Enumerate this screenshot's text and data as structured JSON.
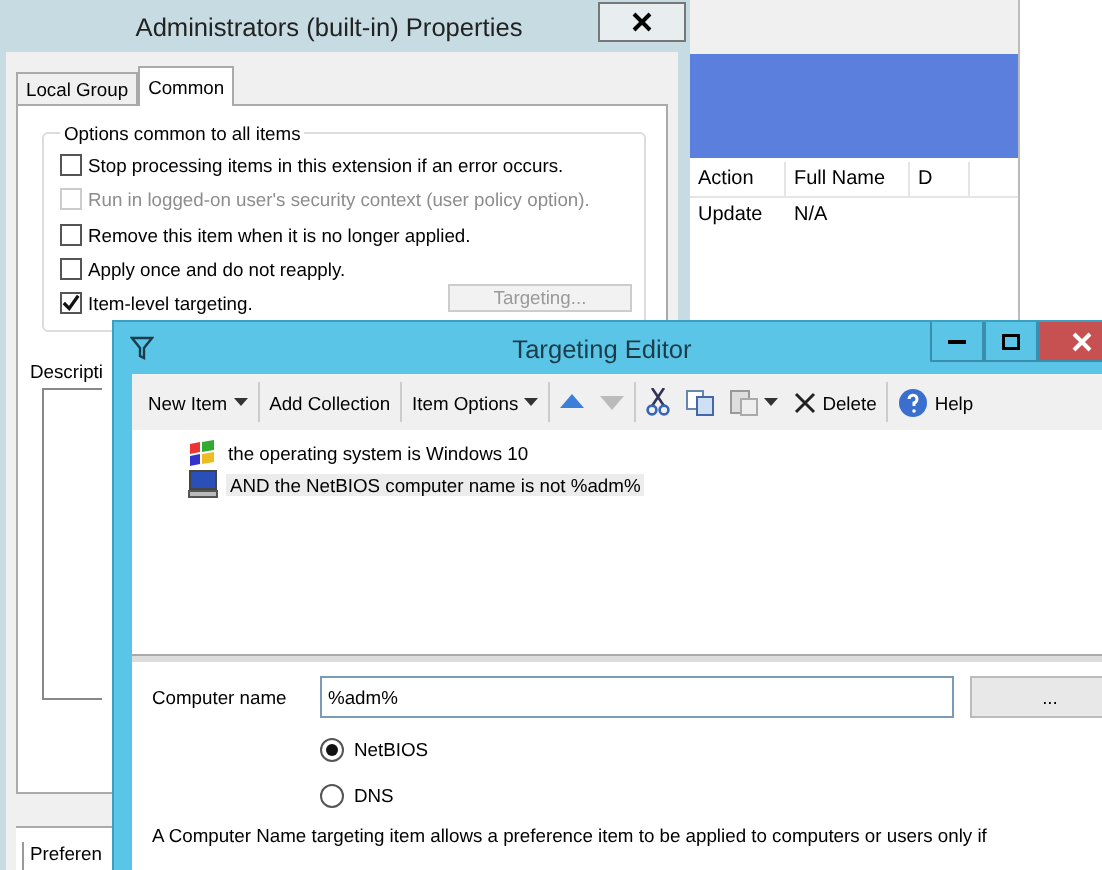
{
  "background_window": {
    "columns": [
      "Action",
      "Full Name",
      "D"
    ],
    "rows": [
      [
        "Update",
        "N/A"
      ]
    ]
  },
  "properties_dialog": {
    "title": "Administrators (built-in) Properties",
    "tabs": [
      {
        "label": "Local Group",
        "selected": false
      },
      {
        "label": "Common",
        "selected": true
      }
    ],
    "group_title": "Options common to all items",
    "options": [
      {
        "label": "Stop processing items in this extension if an error occurs.",
        "checked": false,
        "disabled": false
      },
      {
        "label": "Run in logged-on user's security context (user policy option).",
        "checked": false,
        "disabled": true
      },
      {
        "label": "Remove this item when it is no longer applied.",
        "checked": false,
        "disabled": false
      },
      {
        "label": "Apply once and do not reapply.",
        "checked": false,
        "disabled": false
      },
      {
        "label": "Item-level targeting.",
        "checked": true,
        "disabled": false
      }
    ],
    "targeting_button": {
      "label": "Targeting...",
      "disabled": true
    },
    "description_label": "Descripti",
    "bottom_tab": "Preferen"
  },
  "targeting_editor": {
    "title": "Targeting Editor",
    "toolbar": {
      "new_item": "New Item",
      "add_collection": "Add Collection",
      "item_options": "Item Options",
      "move_down_disabled": true,
      "paste_disabled": true,
      "delete": "Delete",
      "help": "Help"
    },
    "items": [
      {
        "kind": "os",
        "text": "the operating system is Windows 10",
        "selected": false
      },
      {
        "kind": "computer",
        "text": "AND the NetBIOS computer name is not %adm%",
        "selected": true
      }
    ],
    "field": {
      "label": "Computer name",
      "value": "%adm%"
    },
    "browse": "...",
    "radios": [
      {
        "label": "NetBIOS",
        "selected": true
      },
      {
        "label": "DNS",
        "selected": false
      }
    ],
    "description": "A Computer Name targeting item allows a preference item to be applied to computers or users only if"
  }
}
